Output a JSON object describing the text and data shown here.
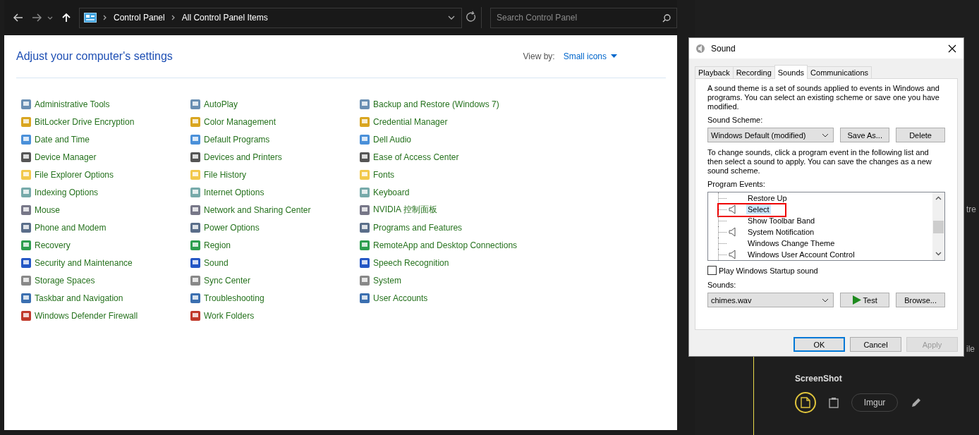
{
  "explorer": {
    "breadcrumb": [
      "Control Panel",
      "All Control Panel Items"
    ],
    "search": {
      "placeholder": "Search Control Panel"
    },
    "heading": "Adjust your computer's settings",
    "view_by": {
      "label": "View by:",
      "value": "Small icons"
    },
    "items": [
      "Administrative Tools",
      "BitLocker Drive Encryption",
      "Date and Time",
      "Device Manager",
      "File Explorer Options",
      "Indexing Options",
      "Mouse",
      "Phone and Modem",
      "Recovery",
      "Security and Maintenance",
      "Storage Spaces",
      "Taskbar and Navigation",
      "Windows Defender Firewall",
      "AutoPlay",
      "Color Management",
      "Default Programs",
      "Devices and Printers",
      "File History",
      "Internet Options",
      "Network and Sharing Center",
      "Power Options",
      "Region",
      "Sound",
      "Sync Center",
      "Troubleshooting",
      "Work Folders",
      "Backup and Restore (Windows 7)",
      "Credential Manager",
      "Dell Audio",
      "Ease of Access Center",
      "Fonts",
      "Keyboard",
      "NVIDIA 控制面板",
      "Programs and Features",
      "RemoteApp and Desktop Connections",
      "Speech Recognition",
      "System",
      "User Accounts"
    ]
  },
  "dialog": {
    "title": "Sound",
    "tabs": [
      {
        "label": "Playback",
        "selected": false
      },
      {
        "label": "Recording",
        "selected": false
      },
      {
        "label": "Sounds",
        "selected": true
      },
      {
        "label": "Communications",
        "selected": false
      }
    ],
    "intro": "A sound theme is a set of sounds applied to events in Windows and programs.  You can select an existing scheme or save one you have modified.",
    "scheme_label": "Sound Scheme:",
    "scheme": "Windows Default (modified)",
    "scheme_buttons": [
      "Save As...",
      "Delete"
    ],
    "events_intro": "To change sounds, click a program event in the following list and then select a sound to apply.  You can save the changes as a new sound scheme.",
    "events_label": "Program Events:",
    "events": [
      {
        "label": "Restore Up",
        "kind": "plain",
        "selected": false,
        "marked": false
      },
      {
        "label": "Select",
        "kind": "speaker",
        "selected": true,
        "marked": true
      },
      {
        "label": "Show Toolbar Band",
        "kind": "plain",
        "selected": false,
        "marked": false
      },
      {
        "label": "System Notification",
        "kind": "speaker",
        "selected": false,
        "marked": false
      },
      {
        "label": "Windows Change Theme",
        "kind": "plain",
        "selected": false,
        "marked": false
      },
      {
        "label": "Windows User Account Control",
        "kind": "speaker",
        "selected": false,
        "marked": false
      }
    ],
    "startup": {
      "label": "Play Windows Startup sound",
      "checked": false
    },
    "sounds_label": "Sounds:",
    "sound": "chimes.wav",
    "sound_buttons": [
      {
        "label": "Test",
        "kind": "play"
      },
      {
        "label": "Browse...",
        "kind": "plain"
      }
    ],
    "buttons": [
      {
        "label": "OK",
        "default": true,
        "disabled": false
      },
      {
        "label": "Cancel",
        "default": false,
        "disabled": false
      },
      {
        "label": "Apply",
        "default": false,
        "disabled": true
      }
    ]
  },
  "background_app": {
    "fragments": [
      "tre",
      "ile"
    ],
    "section_title": "ScreenShot",
    "imgur_button": "Imgur"
  }
}
